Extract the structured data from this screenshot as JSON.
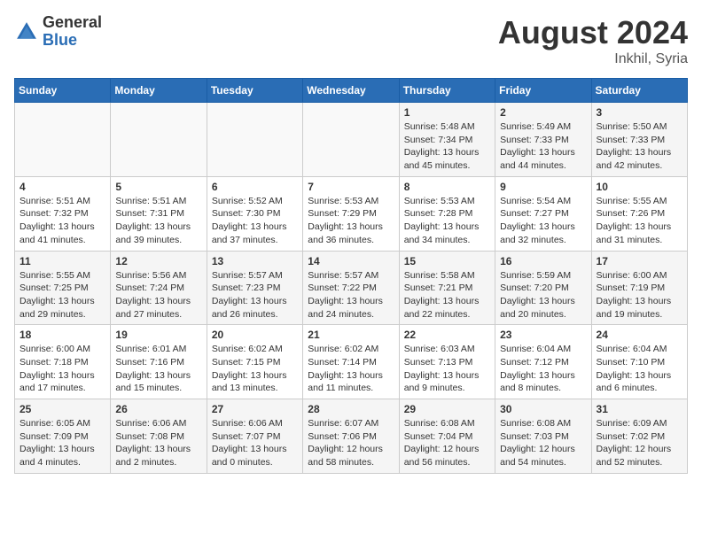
{
  "header": {
    "logo": {
      "general": "General",
      "blue": "Blue"
    },
    "month_year": "August 2024",
    "location": "Inkhil, Syria"
  },
  "weekdays": [
    "Sunday",
    "Monday",
    "Tuesday",
    "Wednesday",
    "Thursday",
    "Friday",
    "Saturday"
  ],
  "weeks": [
    [
      {
        "day": "",
        "info": ""
      },
      {
        "day": "",
        "info": ""
      },
      {
        "day": "",
        "info": ""
      },
      {
        "day": "",
        "info": ""
      },
      {
        "day": "1",
        "info": "Sunrise: 5:48 AM\nSunset: 7:34 PM\nDaylight: 13 hours\nand 45 minutes."
      },
      {
        "day": "2",
        "info": "Sunrise: 5:49 AM\nSunset: 7:33 PM\nDaylight: 13 hours\nand 44 minutes."
      },
      {
        "day": "3",
        "info": "Sunrise: 5:50 AM\nSunset: 7:33 PM\nDaylight: 13 hours\nand 42 minutes."
      }
    ],
    [
      {
        "day": "4",
        "info": "Sunrise: 5:51 AM\nSunset: 7:32 PM\nDaylight: 13 hours\nand 41 minutes."
      },
      {
        "day": "5",
        "info": "Sunrise: 5:51 AM\nSunset: 7:31 PM\nDaylight: 13 hours\nand 39 minutes."
      },
      {
        "day": "6",
        "info": "Sunrise: 5:52 AM\nSunset: 7:30 PM\nDaylight: 13 hours\nand 37 minutes."
      },
      {
        "day": "7",
        "info": "Sunrise: 5:53 AM\nSunset: 7:29 PM\nDaylight: 13 hours\nand 36 minutes."
      },
      {
        "day": "8",
        "info": "Sunrise: 5:53 AM\nSunset: 7:28 PM\nDaylight: 13 hours\nand 34 minutes."
      },
      {
        "day": "9",
        "info": "Sunrise: 5:54 AM\nSunset: 7:27 PM\nDaylight: 13 hours\nand 32 minutes."
      },
      {
        "day": "10",
        "info": "Sunrise: 5:55 AM\nSunset: 7:26 PM\nDaylight: 13 hours\nand 31 minutes."
      }
    ],
    [
      {
        "day": "11",
        "info": "Sunrise: 5:55 AM\nSunset: 7:25 PM\nDaylight: 13 hours\nand 29 minutes."
      },
      {
        "day": "12",
        "info": "Sunrise: 5:56 AM\nSunset: 7:24 PM\nDaylight: 13 hours\nand 27 minutes."
      },
      {
        "day": "13",
        "info": "Sunrise: 5:57 AM\nSunset: 7:23 PM\nDaylight: 13 hours\nand 26 minutes."
      },
      {
        "day": "14",
        "info": "Sunrise: 5:57 AM\nSunset: 7:22 PM\nDaylight: 13 hours\nand 24 minutes."
      },
      {
        "day": "15",
        "info": "Sunrise: 5:58 AM\nSunset: 7:21 PM\nDaylight: 13 hours\nand 22 minutes."
      },
      {
        "day": "16",
        "info": "Sunrise: 5:59 AM\nSunset: 7:20 PM\nDaylight: 13 hours\nand 20 minutes."
      },
      {
        "day": "17",
        "info": "Sunrise: 6:00 AM\nSunset: 7:19 PM\nDaylight: 13 hours\nand 19 minutes."
      }
    ],
    [
      {
        "day": "18",
        "info": "Sunrise: 6:00 AM\nSunset: 7:18 PM\nDaylight: 13 hours\nand 17 minutes."
      },
      {
        "day": "19",
        "info": "Sunrise: 6:01 AM\nSunset: 7:16 PM\nDaylight: 13 hours\nand 15 minutes."
      },
      {
        "day": "20",
        "info": "Sunrise: 6:02 AM\nSunset: 7:15 PM\nDaylight: 13 hours\nand 13 minutes."
      },
      {
        "day": "21",
        "info": "Sunrise: 6:02 AM\nSunset: 7:14 PM\nDaylight: 13 hours\nand 11 minutes."
      },
      {
        "day": "22",
        "info": "Sunrise: 6:03 AM\nSunset: 7:13 PM\nDaylight: 13 hours\nand 9 minutes."
      },
      {
        "day": "23",
        "info": "Sunrise: 6:04 AM\nSunset: 7:12 PM\nDaylight: 13 hours\nand 8 minutes."
      },
      {
        "day": "24",
        "info": "Sunrise: 6:04 AM\nSunset: 7:10 PM\nDaylight: 13 hours\nand 6 minutes."
      }
    ],
    [
      {
        "day": "25",
        "info": "Sunrise: 6:05 AM\nSunset: 7:09 PM\nDaylight: 13 hours\nand 4 minutes."
      },
      {
        "day": "26",
        "info": "Sunrise: 6:06 AM\nSunset: 7:08 PM\nDaylight: 13 hours\nand 2 minutes."
      },
      {
        "day": "27",
        "info": "Sunrise: 6:06 AM\nSunset: 7:07 PM\nDaylight: 13 hours\nand 0 minutes."
      },
      {
        "day": "28",
        "info": "Sunrise: 6:07 AM\nSunset: 7:06 PM\nDaylight: 12 hours\nand 58 minutes."
      },
      {
        "day": "29",
        "info": "Sunrise: 6:08 AM\nSunset: 7:04 PM\nDaylight: 12 hours\nand 56 minutes."
      },
      {
        "day": "30",
        "info": "Sunrise: 6:08 AM\nSunset: 7:03 PM\nDaylight: 12 hours\nand 54 minutes."
      },
      {
        "day": "31",
        "info": "Sunrise: 6:09 AM\nSunset: 7:02 PM\nDaylight: 12 hours\nand 52 minutes."
      }
    ]
  ]
}
